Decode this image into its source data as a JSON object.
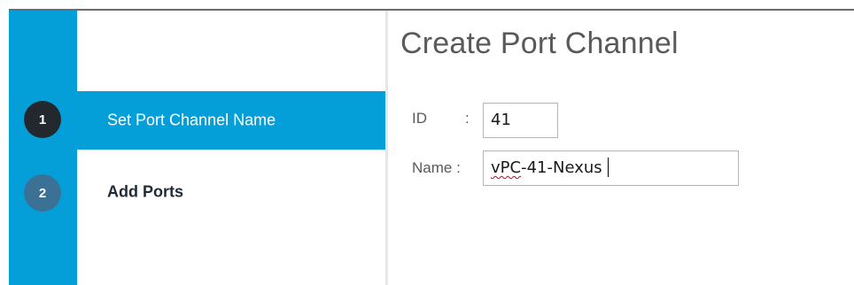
{
  "wizard": {
    "title": "Create Port Channel",
    "steps": [
      {
        "number": "1",
        "label": "Set Port Channel Name",
        "state": "active"
      },
      {
        "number": "2",
        "label": "Add Ports",
        "state": "inactive"
      }
    ]
  },
  "form": {
    "id": {
      "label": "ID",
      "separator": ":",
      "value": "41"
    },
    "name": {
      "label": "Name :",
      "value_prefix": "vPC",
      "value_rest": "-41-Nexus"
    }
  },
  "colors": {
    "accent": "#049fd9",
    "active_step_circle": "#23282e",
    "inactive_step_circle": "#3b7194",
    "title_text": "#58595b"
  }
}
